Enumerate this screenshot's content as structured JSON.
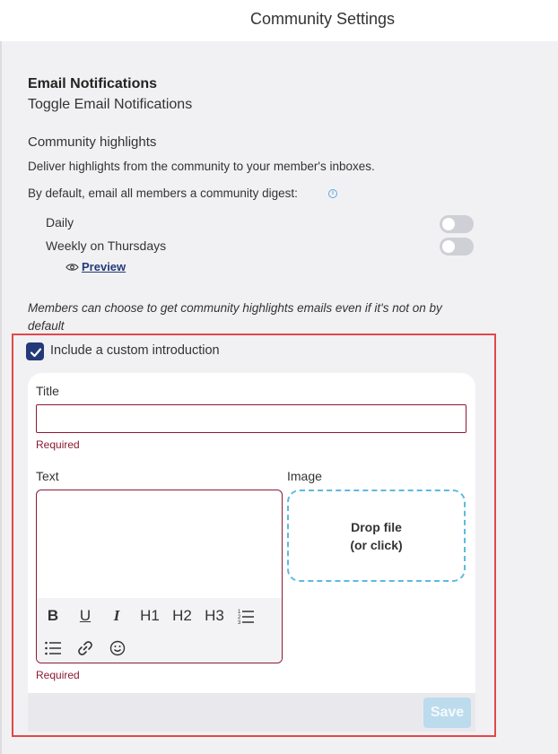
{
  "header": {
    "title": "Community Settings"
  },
  "email": {
    "heading": "Email Notifications",
    "subheading": "Toggle Email Notifications"
  },
  "highlights": {
    "title": "Community highlights",
    "description": "Deliver highlights from the community to your member's inboxes.",
    "default_text": "By default, email all members a community digest:",
    "info_icon": "i",
    "toggles": [
      {
        "label": "Daily",
        "on": false
      },
      {
        "label": "Weekly on Thursdays",
        "on": false
      }
    ],
    "preview_label": "Preview",
    "members_note": "Members can choose to get community highlights emails even if it's not on by default"
  },
  "intro": {
    "checkbox_label": "Include a custom introduction",
    "checked": true,
    "title_label": "Title",
    "title_value": "",
    "title_required": "Required",
    "text_label": "Text",
    "text_required": "Required",
    "image_label": "Image",
    "drop_line1": "Drop file",
    "drop_line2": "(or click)",
    "toolbar": {
      "bold": "B",
      "underline": "U",
      "italic": "I",
      "h1": "H1",
      "h2": "H2",
      "h3": "H3"
    },
    "save_label": "Save"
  },
  "colors": {
    "accent": "#233a78",
    "error": "#8b1a34",
    "dropzone": "#5bbbe0",
    "save_disabled": "#bcdcee"
  }
}
